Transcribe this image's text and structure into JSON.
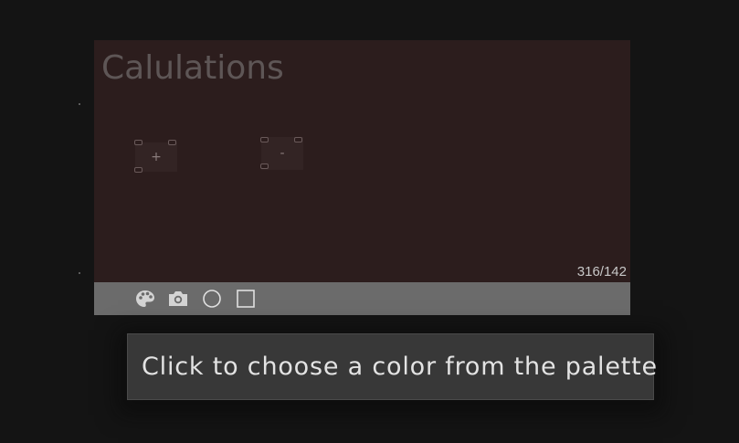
{
  "group": {
    "title": "Calulations",
    "size_readout": "316/142",
    "background_color": "#2c1d1d"
  },
  "nodes": [
    {
      "label": "+"
    },
    {
      "label": "-"
    }
  ],
  "toolbar": {
    "tools": [
      {
        "name": "palette-icon",
        "hint": "color"
      },
      {
        "name": "camera-icon",
        "hint": "screenshot"
      },
      {
        "name": "circle-icon",
        "hint": "shape-circle"
      },
      {
        "name": "square-icon",
        "hint": "shape-square"
      }
    ]
  },
  "tooltip": {
    "text": "Click to choose a color from the palette"
  }
}
